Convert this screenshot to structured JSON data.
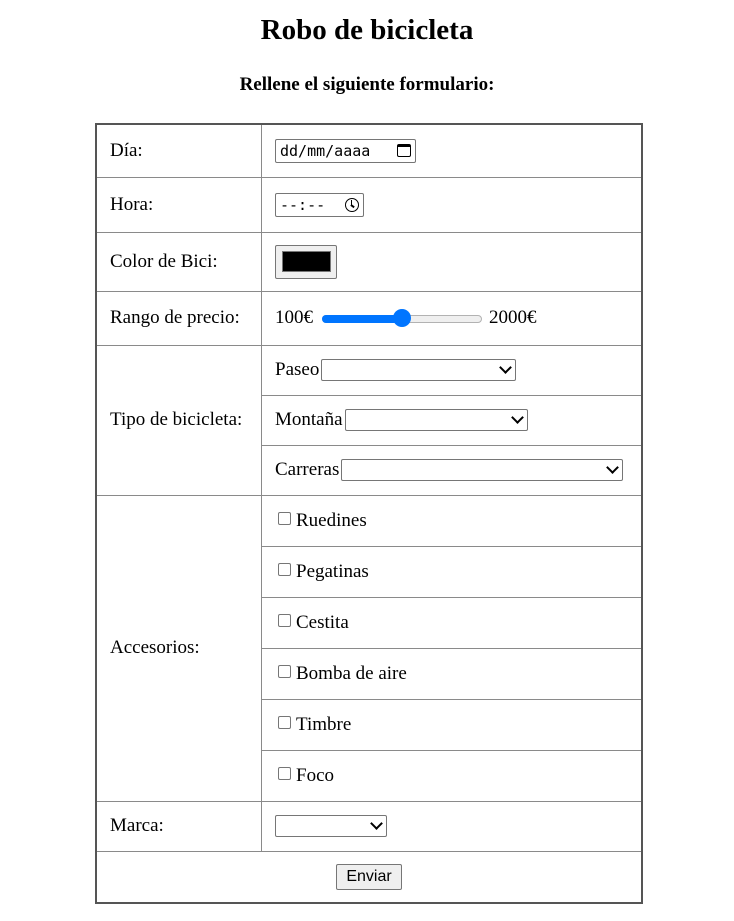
{
  "page": {
    "title": "Robo de bicicleta",
    "subtitle": "Rellene el siguiente formulario:"
  },
  "form": {
    "day": {
      "label": "Día:",
      "placeholder": "dd/mm/aaaa"
    },
    "hour": {
      "label": "Hora:",
      "placeholder": "--:--"
    },
    "color": {
      "label": "Color de Bici:",
      "value": "#000000"
    },
    "price": {
      "label": "Rango de precio:",
      "min_label": "100€",
      "max_label": "2000€",
      "min": 100,
      "max": 2000,
      "value": 1050
    },
    "bike_type": {
      "label": "Tipo de bicicleta:",
      "options": [
        {
          "label": "Paseo",
          "selected": ""
        },
        {
          "label": "Montaña",
          "selected": ""
        },
        {
          "label": "Carreras",
          "selected": ""
        }
      ]
    },
    "accessories": {
      "label": "Accesorios:",
      "items": [
        "Ruedines",
        "Pegatinas",
        "Cestita",
        "Bomba de aire",
        "Timbre",
        "Foco"
      ]
    },
    "brand": {
      "label": "Marca:",
      "selected": ""
    },
    "submit_label": "Enviar"
  },
  "colors": {
    "accent": "#0075ff",
    "border": "#8a8a8a"
  }
}
